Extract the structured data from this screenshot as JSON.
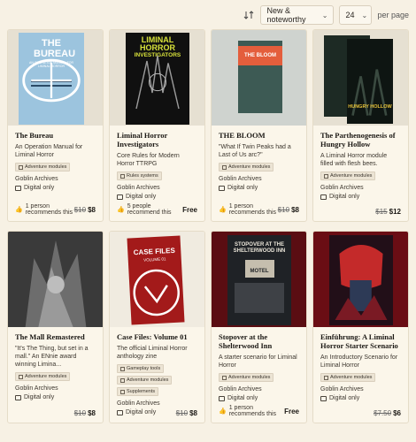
{
  "toolbar": {
    "sort_value": "New & noteworthy",
    "per_page_value": "24",
    "per_page_label": "per page"
  },
  "products": [
    {
      "title": "The Bureau",
      "description": "An Operation Manual for Liminal Horror",
      "tags": [
        "Adventure modules"
      ],
      "publisher": "Goblin Archives",
      "format": "Digital only",
      "recommendations": "1 person recommends this",
      "old_price": "$10",
      "price": "$8",
      "cover": {
        "bg": "#9cc4de",
        "title": "THE BUREAU",
        "subtitle": "AN OPERATION MANUAL FOR LIMINAL HORROR"
      }
    },
    {
      "title": "Liminal Horror Investigators",
      "description": "Core Rules for Modern Horror TTRPG",
      "tags": [
        "Rules systems"
      ],
      "publisher": "Goblin Archives",
      "format": "Digital only",
      "recommendations": "5 people recommend this",
      "old_price": "",
      "price": "Free",
      "cover": {
        "bg": "#101010",
        "title": "LIMINAL HORROR",
        "subtitle": "INVESTIGATORS"
      }
    },
    {
      "title": "THE BLOOM",
      "description": "\"What If Twin Peaks had a Last of Us arc?\"",
      "tags": [
        "Adventure modules"
      ],
      "publisher": "Goblin Archives",
      "format": "Digital only",
      "recommendations": "1 person recommends this",
      "old_price": "$10",
      "price": "$8",
      "cover": {
        "bg": "#cfd3cf",
        "title": "THE BLOOM",
        "subtitle": ""
      }
    },
    {
      "title": "The Parthenogenesis of Hungry Hollow",
      "description": "A Liminal Horror module filled with flesh bees.",
      "tags": [
        "Adventure modules"
      ],
      "publisher": "Goblin Archives",
      "format": "Digital only",
      "recommendations": "",
      "old_price": "$15",
      "price": "$12",
      "cover": {
        "bg": "#1d2a24",
        "title": "HUNGRY HOLLOW",
        "subtitle": ""
      }
    },
    {
      "title": "The Mall Remastered",
      "description": "\"It's The Thing, but set in a mall.\" An ENnie award winning Limina...",
      "tags": [
        "Adventure modules"
      ],
      "publisher": "Goblin Archives",
      "format": "Digital only",
      "recommendations": "",
      "old_price": "$10",
      "price": "$8",
      "cover": {
        "bg": "#2a2a2a",
        "title": "",
        "subtitle": ""
      }
    },
    {
      "title": "Case Files: Volume 01",
      "description": "The official Liminal Horror anthology zine",
      "tags": [
        "Gameplay tools",
        "Adventure modules",
        "Supplements"
      ],
      "publisher": "Goblin Archives",
      "format": "Digital only",
      "recommendations": "",
      "old_price": "$10",
      "price": "$8",
      "cover": {
        "bg": "#a31a1a",
        "title": "CASE FILES",
        "subtitle": "VOLUME 01"
      }
    },
    {
      "title": "Stopover at the Shelterwood Inn",
      "description": "A starter scenario for Liminal Horror",
      "tags": [
        "Adventure modules"
      ],
      "publisher": "Goblin Archives",
      "format": "Digital only",
      "recommendations": "1 person recommends this",
      "old_price": "",
      "price": "Free",
      "cover": {
        "bg": "#5a0d12",
        "title": "STOPOVER AT THE SHELTERWOOD INN",
        "subtitle": "MOTEL"
      }
    },
    {
      "title": "Einführung: A Liminal Horror Starter Scenario",
      "description": "An Introductory Scenario for Liminal Horror",
      "tags": [
        "Adventure modules"
      ],
      "publisher": "Goblin Archives",
      "format": "Digital only",
      "recommendations": "",
      "old_price": "$7.50",
      "price": "$6",
      "cover": {
        "bg": "#6a0d14",
        "title": "",
        "subtitle": ""
      }
    }
  ]
}
